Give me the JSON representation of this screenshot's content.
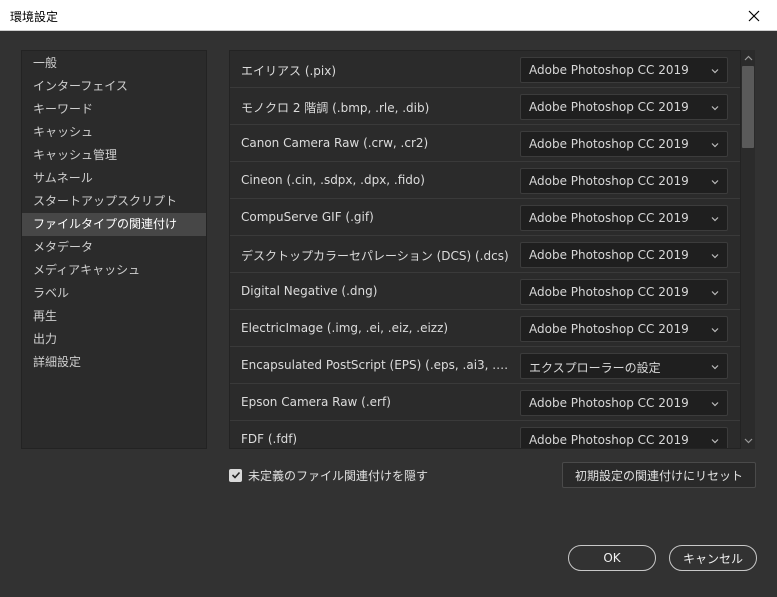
{
  "window": {
    "title": "環境設定",
    "close_icon": "close-icon"
  },
  "sidebar": {
    "items": [
      {
        "label": "一般"
      },
      {
        "label": "インターフェイス"
      },
      {
        "label": "キーワード"
      },
      {
        "label": "キャッシュ"
      },
      {
        "label": "キャッシュ管理"
      },
      {
        "label": "サムネール"
      },
      {
        "label": "スタートアップスクリプト"
      },
      {
        "label": "ファイルタイプの関連付け",
        "selected": true
      },
      {
        "label": "メタデータ"
      },
      {
        "label": "メディアキャッシュ"
      },
      {
        "label": "ラベル"
      },
      {
        "label": "再生"
      },
      {
        "label": "出力"
      },
      {
        "label": "詳細設定"
      }
    ]
  },
  "associations": [
    {
      "file_type": "エイリアス (.pix)",
      "app": "Adobe Photoshop CC 2019"
    },
    {
      "file_type": "モノクロ 2 階調 (.bmp, .rle, .dib)",
      "app": "Adobe Photoshop CC 2019"
    },
    {
      "file_type": "Canon Camera Raw (.crw, .cr2)",
      "app": "Adobe Photoshop CC 2019"
    },
    {
      "file_type": "Cineon (.cin, .sdpx, .dpx, .fido)",
      "app": "Adobe Photoshop CC 2019"
    },
    {
      "file_type": "CompuServe GIF (.gif)",
      "app": "Adobe Photoshop CC 2019"
    },
    {
      "file_type": "デスクトップカラーセパレーション (DCS) (.dcs)",
      "app": "Adobe Photoshop CC 2019"
    },
    {
      "file_type": "Digital Negative (.dng)",
      "app": "Adobe Photoshop CC 2019"
    },
    {
      "file_type": "ElectricImage (.img, .ei, .eiz, .eizz)",
      "app": "Adobe Photoshop CC 2019"
    },
    {
      "file_type": "Encapsulated PostScript (EPS) (.eps, .ai3, .ai4, .ai5, ...",
      "app": "エクスプローラーの設定"
    },
    {
      "file_type": "Epson Camera Raw (.erf)",
      "app": "Adobe Photoshop CC 2019"
    },
    {
      "file_type": "FDF (.fdf)",
      "app": "Adobe Photoshop CC 2019"
    }
  ],
  "options": {
    "hide_undefined_label": "未定義のファイル関連付けを隠す",
    "hide_undefined_checked": true,
    "reset_label": "初期設定の関連付けにリセット"
  },
  "buttons": {
    "ok_label": "OK",
    "cancel_label": "キャンセル"
  },
  "colors": {
    "background": "#323232",
    "panel": "#2b2b2b",
    "selected": "#474747",
    "dropdown": "#1f1f1f"
  }
}
